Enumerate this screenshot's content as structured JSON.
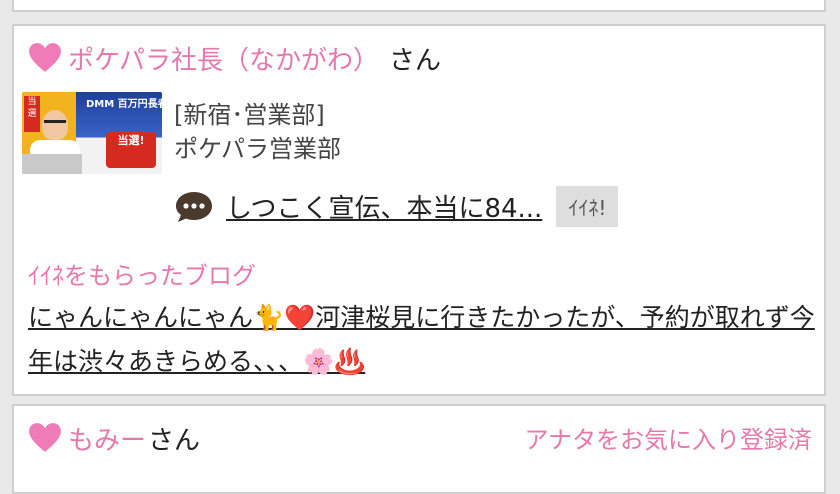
{
  "post1": {
    "user_name": "ポケパラ社長（なかがわ）",
    "honorific": "さん",
    "profile": {
      "thumb_text_dmm": "DMM 百万円長者",
      "thumb_text_prize": "当選!",
      "location": "[新宿･営業部]",
      "shop": "ポケパラ営業部"
    },
    "comment_link": "しつこく宣伝、本当に84...",
    "like_button": "ｲｲﾈ!",
    "liked_blog_label": "ｲｲﾈをもらったブログ",
    "blog_title": "にゃんにゃんにゃん🐈❤️河津桜見に行きたかったが、予約が取れず今年は渋々あきらめる、、、🌸♨️"
  },
  "post2": {
    "user_name": "もみー",
    "honorific": "さん",
    "status": "アナタをお気に入り登録済"
  },
  "colors": {
    "accent_pink": "#e678ad",
    "heart_pink": "#f07cb7",
    "button_gray": "#dedede"
  },
  "icons": {
    "heart": "heart-icon",
    "comment": "speech-bubble-icon"
  }
}
